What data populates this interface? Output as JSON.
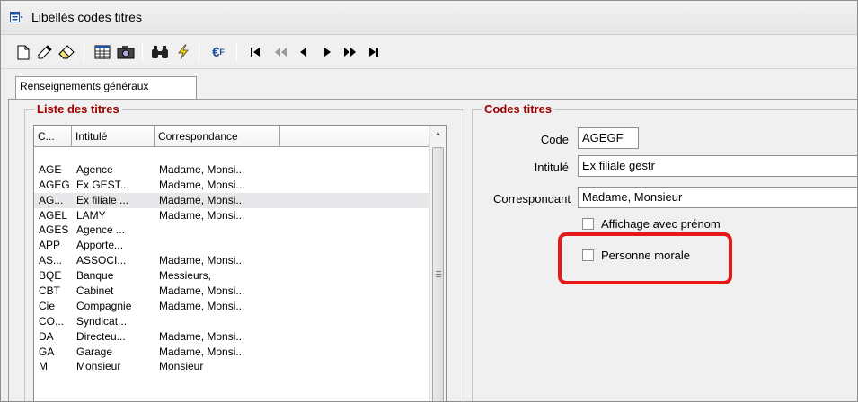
{
  "window": {
    "title": "Libellés codes titres"
  },
  "tabs": [
    {
      "label": "Renseignements généraux"
    }
  ],
  "list_group": {
    "title": "Liste des titres",
    "columns": [
      "C...",
      "Intitulé",
      "Correspondance"
    ],
    "rows": [
      [
        "",
        "",
        ""
      ],
      [
        "AGE",
        "Agence",
        "Madame, Monsi..."
      ],
      [
        "AGEG",
        "Ex GEST...",
        "Madame, Monsi..."
      ],
      [
        "AG...",
        "Ex filiale ...",
        "Madame, Monsi..."
      ],
      [
        "AGEL",
        "LAMY",
        "Madame, Monsi..."
      ],
      [
        "AGES",
        "Agence ...",
        ""
      ],
      [
        "APP",
        "Apporte...",
        ""
      ],
      [
        "AS...",
        "ASSOCI...",
        "Madame, Monsi..."
      ],
      [
        "BQE",
        "Banque",
        "Messieurs,"
      ],
      [
        "CBT",
        "Cabinet",
        "Madame, Monsi..."
      ],
      [
        "Cie",
        "Compagnie",
        "Madame, Monsi..."
      ],
      [
        "CO...",
        "Syndicat...",
        ""
      ],
      [
        "DA",
        "Directeu...",
        "Madame, Monsi..."
      ],
      [
        "GA",
        "Garage",
        "Madame, Monsi..."
      ],
      [
        "M",
        "Monsieur",
        "Monsieur"
      ]
    ]
  },
  "codes_group": {
    "title": "Codes titres",
    "code_label": "Code",
    "code_value": "AGEGF",
    "intitule_label": "Intitulé",
    "intitule_value": "Ex filiale gestr",
    "correspondant_label": "Correspondant",
    "correspondant_value": "Madame, Monsieur",
    "affichage_label": "Affichage avec prénom",
    "affichage_checked": false,
    "personne_label": "Personne morale",
    "personne_checked": false
  },
  "toolbar": {
    "icons": [
      "new-document-icon",
      "pencil-icon",
      "eraser-icon",
      "grid-icon",
      "camera-icon",
      "binoculars-icon",
      "lightning-icon",
      "euro-currency-icon",
      "first-record-icon",
      "rewind-icon",
      "previous-icon",
      "next-icon",
      "fast-forward-icon",
      "last-record-icon"
    ]
  },
  "colors": {
    "group_title": "#a00000",
    "highlight": "#e5191a"
  }
}
